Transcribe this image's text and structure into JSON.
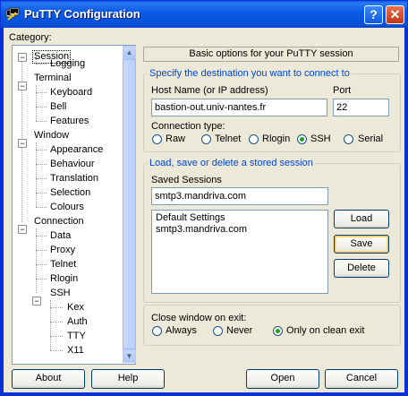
{
  "window": {
    "title": "PuTTY Configuration",
    "help_button": "?",
    "close_button": "✕"
  },
  "category": {
    "label": "Category:",
    "items": [
      {
        "label": "Session",
        "level": 0,
        "expanded": true,
        "selected": true
      },
      {
        "label": "Logging",
        "level": 1
      },
      {
        "label": "Terminal",
        "level": 0,
        "expanded": true
      },
      {
        "label": "Keyboard",
        "level": 1
      },
      {
        "label": "Bell",
        "level": 1
      },
      {
        "label": "Features",
        "level": 1
      },
      {
        "label": "Window",
        "level": 0,
        "expanded": true
      },
      {
        "label": "Appearance",
        "level": 1
      },
      {
        "label": "Behaviour",
        "level": 1
      },
      {
        "label": "Translation",
        "level": 1
      },
      {
        "label": "Selection",
        "level": 1
      },
      {
        "label": "Colours",
        "level": 1
      },
      {
        "label": "Connection",
        "level": 0,
        "expanded": true
      },
      {
        "label": "Data",
        "level": 1
      },
      {
        "label": "Proxy",
        "level": 1
      },
      {
        "label": "Telnet",
        "level": 1
      },
      {
        "label": "Rlogin",
        "level": 1
      },
      {
        "label": "SSH",
        "level": 1,
        "expanded": true
      },
      {
        "label": "Kex",
        "level": 2
      },
      {
        "label": "Auth",
        "level": 2
      },
      {
        "label": "TTY",
        "level": 2
      },
      {
        "label": "X11",
        "level": 2
      }
    ]
  },
  "panel": {
    "header": "Basic options for your PuTTY session",
    "destination": {
      "group_label": "Specify the destination you want to connect to",
      "host_label": "Host Name (or IP address)",
      "host_value": "bastion-out.univ-nantes.fr",
      "port_label": "Port",
      "port_value": "22",
      "conn_type_label": "Connection type:",
      "conn_types": [
        "Raw",
        "Telnet",
        "Rlogin",
        "SSH",
        "Serial"
      ],
      "selected_conn_type": "SSH"
    },
    "sessions": {
      "group_label": "Load, save or delete a stored session",
      "saved_label": "Saved Sessions",
      "saved_value": "smtp3.mandriva.com",
      "list": [
        "Default Settings",
        "smtp3.mandriva.com"
      ],
      "load": "Load",
      "save": "Save",
      "delete": "Delete"
    },
    "close_on_exit": {
      "label": "Close window on exit:",
      "options": [
        "Always",
        "Never",
        "Only on clean exit"
      ],
      "selected": "Only on clean exit"
    }
  },
  "footer": {
    "about": "About",
    "help": "Help",
    "open": "Open",
    "cancel": "Cancel"
  }
}
